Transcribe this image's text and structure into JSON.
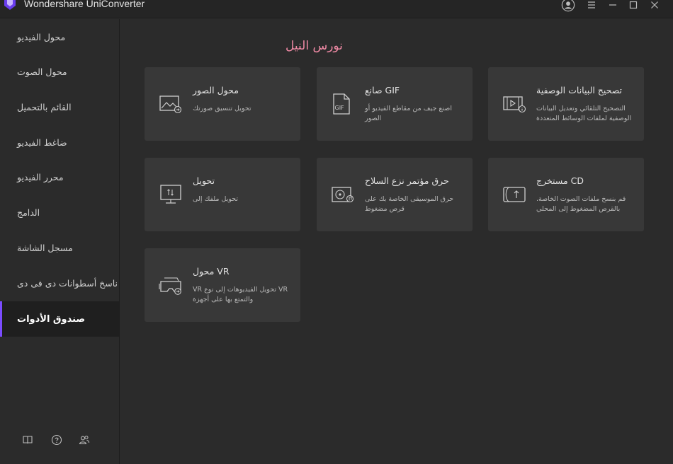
{
  "app": {
    "title": "Wondershare UniConverter"
  },
  "sidebar": {
    "items": [
      {
        "label": "محول الفيديو"
      },
      {
        "label": "محول الصوت"
      },
      {
        "label": "القائم بالتحميل"
      },
      {
        "label": "ضاغط الفيديو"
      },
      {
        "label": "محرر الفيديو"
      },
      {
        "label": "الدامج"
      },
      {
        "label": "مسجل الشاشة"
      },
      {
        "label": "ناسخ أسطوانات دى فى دى"
      },
      {
        "label": "صندوق الأدوات"
      }
    ],
    "active_index": 8
  },
  "main": {
    "watermark": "نورس النيل",
    "cards": [
      {
        "title": "محول الصور",
        "desc": "تحويل تنسيق صورتك",
        "icon": "image-convert-icon"
      },
      {
        "title": "صانع GIF",
        "desc": "اصنع جيف من مقاطع الفيديو أو الصور",
        "icon": "gif-file-icon"
      },
      {
        "title": "تصحيح البيانات الوصفية",
        "desc": "التصحيح التلقائي وتعديل البيانات الوصفية لملفات الوسائط المتعددة",
        "icon": "metadata-video-icon"
      },
      {
        "title": "تحويل",
        "desc": "تحويل ملفك إلى",
        "icon": "monitor-transfer-icon"
      },
      {
        "title": "حرق مؤتمر نزع السلاح",
        "desc": "حرق الموسيقى الخاصة بك على قرص مضغوط",
        "icon": "cd-burn-icon"
      },
      {
        "title": "مستخرج CD",
        "desc": "قم بنسخ ملفات الصوت الخاصة. بالقرص المضغوط إلى المحلي",
        "icon": "cd-ripper-icon"
      },
      {
        "title": "محول VR",
        "desc": "VR تحويل الفيديوهات إلى نوع VR والتمتع بها على أجهزة",
        "icon": "vr-headset-icon"
      }
    ]
  },
  "colors": {
    "accent": "#7b4cff",
    "watermark": "#f08aa5",
    "card_bg": "#383838",
    "bg": "#2b2b2b"
  }
}
